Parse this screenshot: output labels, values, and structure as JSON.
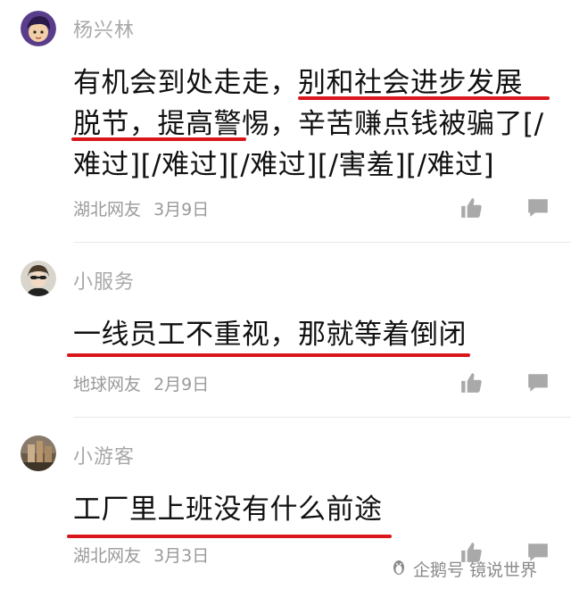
{
  "comments": [
    {
      "username": "杨兴林",
      "text": "有机会到处走走，别和社会进步发展脱节，提高警惕，辛苦赚点钱被骗了[/难过][/难过][/难过][/害羞][/难过]",
      "location": "湖北网友",
      "date": "3月9日"
    },
    {
      "username": "小服务",
      "text": "一线员工不重视，那就等着倒闭",
      "location": "地球网友",
      "date": "2月9日"
    },
    {
      "username": "小游客",
      "text": "工厂里上班没有什么前途",
      "location": "湖北网友",
      "date": "3月3日"
    }
  ],
  "watermark": "企鹅号 镜说世界",
  "colors": {
    "highlight_underline": "#d9161c",
    "meta_text": "#9a9a9a",
    "icon_gray": "#a9a9a9"
  },
  "icons": [
    "thumbs-up-icon",
    "reply-icon",
    "penguin-logo-icon"
  ]
}
